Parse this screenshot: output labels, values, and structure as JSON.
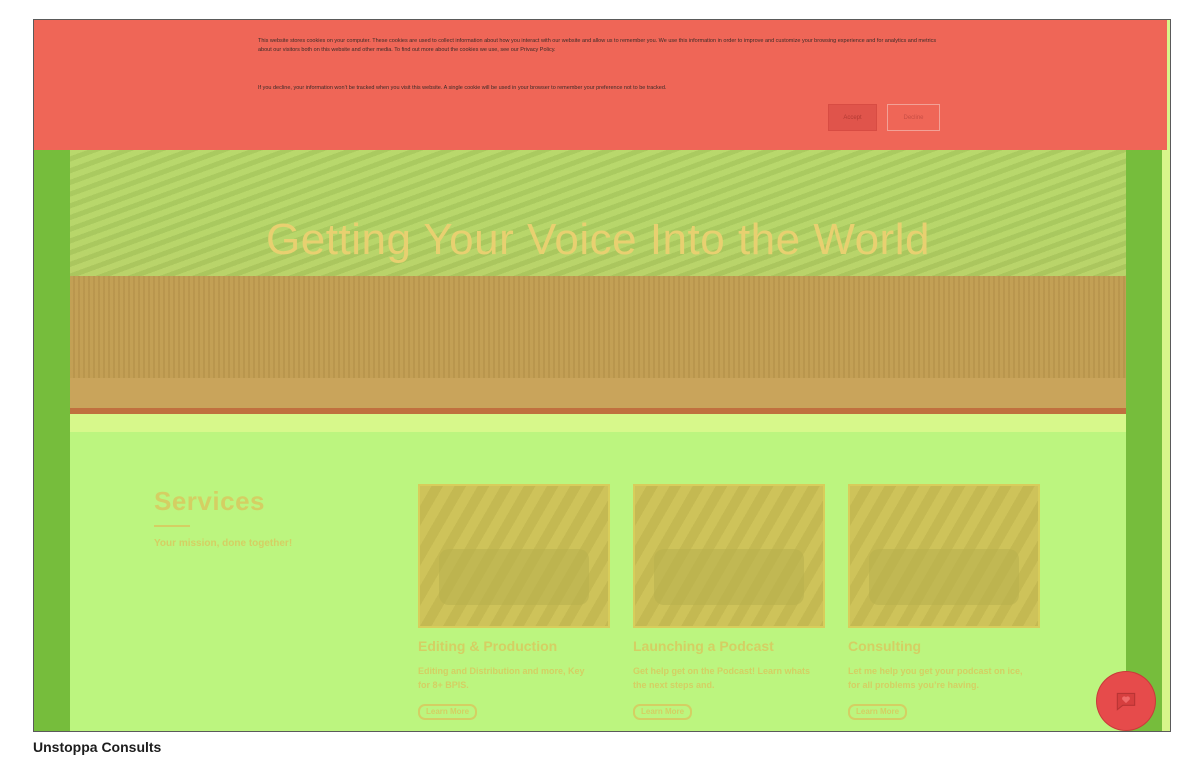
{
  "cookie_banner": {
    "paragraph_1": "This website stores cookies on your computer. These cookies are used to collect information about how you interact with our website and allow us to remember you. We use this information in order to improve and customize your browsing experience and for analytics and metrics about our visitors both on this website and other media. To find out more about the cookies we use, see our Privacy Policy.",
    "paragraph_2": "If you decline, your information won’t be tracked when you visit this website. A single cookie will be used in your browser to remember your preference not to be tracked.",
    "accept_label": "Accept",
    "decline_label": "Decline"
  },
  "hero": {
    "title": "Getting Your Voice Into the World"
  },
  "services": {
    "title": "Services",
    "subtitle": "Your mission, done together!",
    "cards": [
      {
        "title": "Editing & Production",
        "description": "Editing and Distribution and more, Key for 8+ BPIS.",
        "learn_more": "Learn More"
      },
      {
        "title": "Launching a Podcast",
        "description": "Get help get on the Podcast! Learn whats the next steps and.",
        "learn_more": "Learn More"
      },
      {
        "title": "Consulting",
        "description": "Let me help you get your podcast on ice, for all problems you’re having.",
        "learn_more": "Learn More"
      }
    ]
  },
  "chat_widget": {
    "icon": "chat-heart-icon"
  },
  "footer_caption": "Unstoppa Consults"
}
